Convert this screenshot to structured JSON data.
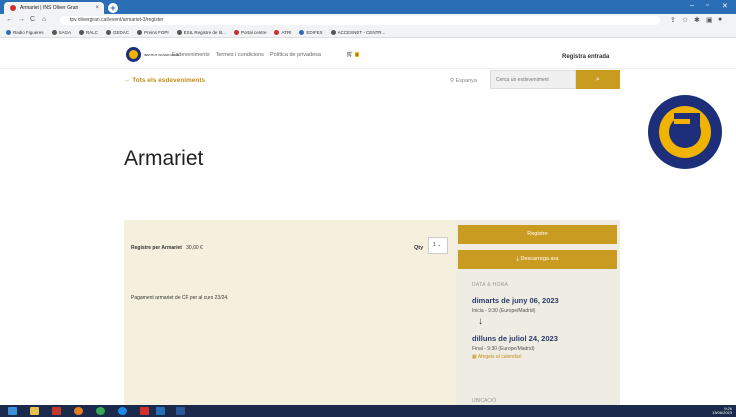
{
  "browser": {
    "tab_title": "Armariet | INS Oliver Gran",
    "tab_close": "×",
    "new_tab": "+",
    "url": "tpv.olivergran.cat/event/armariet-3/register",
    "nav": {
      "back": "←",
      "forward": "→",
      "reload": "C",
      "home": "⌂"
    },
    "bookmarks": [
      "Radio Figueres",
      "SAGA",
      "RALC",
      "GEDAC",
      "Preins FOPI",
      "ESIL Registre de tit...",
      "Portal centre",
      "ATRI",
      "EDIFEX",
      "ACCESNET - CENTR..."
    ],
    "window": {
      "minimize": "–",
      "maximize": "▫",
      "close": "✕"
    }
  },
  "header": {
    "logo_text": "INSTITUT OLIVER GRAN",
    "nav": [
      "Esdeveniments",
      "Termes i condicions",
      "Política de privadesa"
    ],
    "cart_count": "0",
    "login": "Registra entrada"
  },
  "toolbar": {
    "back_label": "← Tots els esdeveniments",
    "location": "Espanya",
    "search_placeholder": "Cerca un esdeveniment",
    "search_icon": "⌕"
  },
  "event": {
    "title": "Armariet",
    "ticket_name": "Registre per Armariet",
    "ticket_price": "30,00 €",
    "qty_label": "Qty",
    "qty_value": "1",
    "description": "Pagament armariet de CF per al curs 23/24.",
    "register_button": "Registre",
    "download_button": "Descarrega ara",
    "datetime_heading": "DATA & HORA",
    "start_date": "dimarts de juny 06, 2023",
    "start_time": "Inicia - 9:30 (Europe/Madrid)",
    "end_date": "dilluns de juliol 24, 2023",
    "end_time": "Final - 9:30 (Europe/Madrid)",
    "add_calendar": "Afegeix al calendari",
    "location_heading": "UBICACIÓ"
  },
  "taskbar": {
    "time": "9:26",
    "date": "13/06/2023"
  }
}
